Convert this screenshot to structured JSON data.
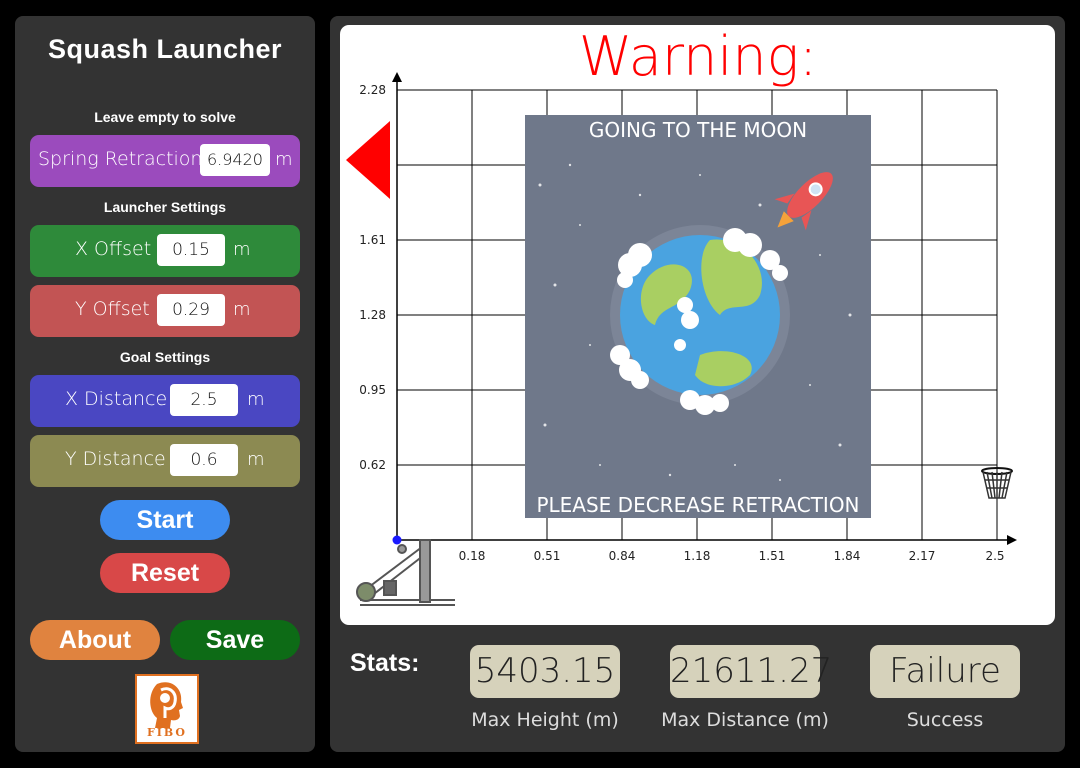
{
  "app": {
    "title": "Squash Launcher",
    "logo_text": "FIBO"
  },
  "left": {
    "solve_hint": "Leave empty to solve",
    "spring": {
      "label": "Spring Retraction",
      "value": "6.9420",
      "unit": "m",
      "color": "#9b4bbd"
    },
    "launcher_heading": "Launcher Settings",
    "x_offset": {
      "label": "X Offset",
      "value": "0.15",
      "unit": "m",
      "color": "#2e8a3a"
    },
    "y_offset": {
      "label": "Y Offset",
      "value": "0.29",
      "unit": "m",
      "color": "#c25454"
    },
    "goal_heading": "Goal Settings",
    "x_distance": {
      "label": "X Distance",
      "value": "2.5",
      "unit": "m",
      "color": "#4a47c2"
    },
    "y_distance": {
      "label": "Y Distance",
      "value": "0.6",
      "unit": "m",
      "color": "#8c8a52"
    },
    "buttons": {
      "start": "Start",
      "reset": "Reset",
      "about": "About",
      "save": "Save"
    }
  },
  "plot": {
    "warning_title": "Warning:",
    "warning_top": "GOING TO THE MOON",
    "warning_bottom": "PLEASE DECREASE RETRACTION",
    "x_ticks": [
      "0.18",
      "0.51",
      "0.84",
      "1.18",
      "1.51",
      "1.84",
      "2.17",
      "2.5"
    ],
    "y_ticks": [
      "2.28",
      "1.61",
      "1.28",
      "0.95",
      "0.62"
    ],
    "accent": "#ff0000"
  },
  "stats": {
    "heading": "Stats:",
    "max_height": {
      "value": "5403.15",
      "label": "Max Height (m)"
    },
    "max_distance": {
      "value": "21611.27",
      "label": "Max Distance (m)"
    },
    "success": {
      "value": "Failure",
      "label": "Success"
    }
  }
}
